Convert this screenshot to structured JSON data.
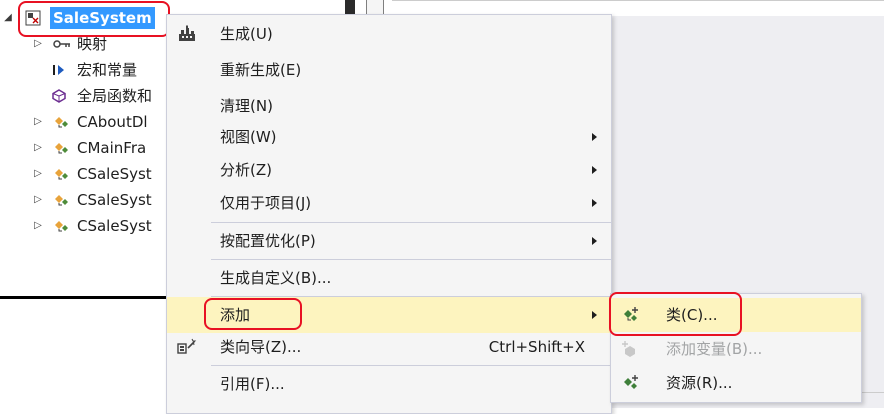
{
  "solution_tree": {
    "root": {
      "label": "SaleSystem",
      "expanded": true
    },
    "items": [
      {
        "label": "映射",
        "icon": "key-icon",
        "expandable": true
      },
      {
        "label": "宏和常量",
        "icon": "macro-icon",
        "expandable": false
      },
      {
        "label": "全局函数和",
        "icon": "global-function-icon",
        "expandable": false
      },
      {
        "label": "CAboutDl",
        "icon": "class-icon",
        "expandable": true
      },
      {
        "label": "CMainFra",
        "icon": "class-icon",
        "expandable": true
      },
      {
        "label": "CSaleSyst",
        "icon": "class-icon",
        "expandable": true
      },
      {
        "label": "CSaleSyst",
        "icon": "class-icon",
        "expandable": true
      },
      {
        "label": "CSaleSyst",
        "icon": "class-icon",
        "expandable": true
      }
    ]
  },
  "context_menu": {
    "items": [
      {
        "label": "生成(U)",
        "icon": "build-icon",
        "submenu": false
      },
      {
        "label": "重新生成(E)",
        "submenu": false
      },
      {
        "label": "清理(N)",
        "submenu": false
      },
      {
        "label": "视图(W)",
        "submenu": true
      },
      {
        "label": "分析(Z)",
        "submenu": true
      },
      {
        "label": "仅用于项目(J)",
        "submenu": true
      },
      {
        "label": "按配置优化(P)",
        "submenu": true
      },
      {
        "label": "生成自定义(B)...",
        "submenu": false
      },
      {
        "label": "添加",
        "submenu": true,
        "highlighted": true
      },
      {
        "label": "类向导(Z)...",
        "icon": "class-wizard-icon",
        "shortcut": "Ctrl+Shift+X",
        "submenu": false
      },
      {
        "label": "引用(F)...",
        "submenu": false
      }
    ]
  },
  "add_submenu": {
    "items": [
      {
        "label": "类(C)...",
        "icon": "class-add-icon",
        "enabled": true,
        "highlighted": true
      },
      {
        "label": "添加变量(B)...",
        "icon": "variable-add-icon",
        "enabled": false
      },
      {
        "label": "资源(R)...",
        "icon": "resource-add-icon",
        "enabled": true
      }
    ]
  },
  "colors": {
    "selection": "#3399ff",
    "menu_background": "#f5f5f5",
    "menu_hover": "#fdf4bf",
    "annotation_outline": "#e81123",
    "disabled_text": "#a2a4a5"
  }
}
